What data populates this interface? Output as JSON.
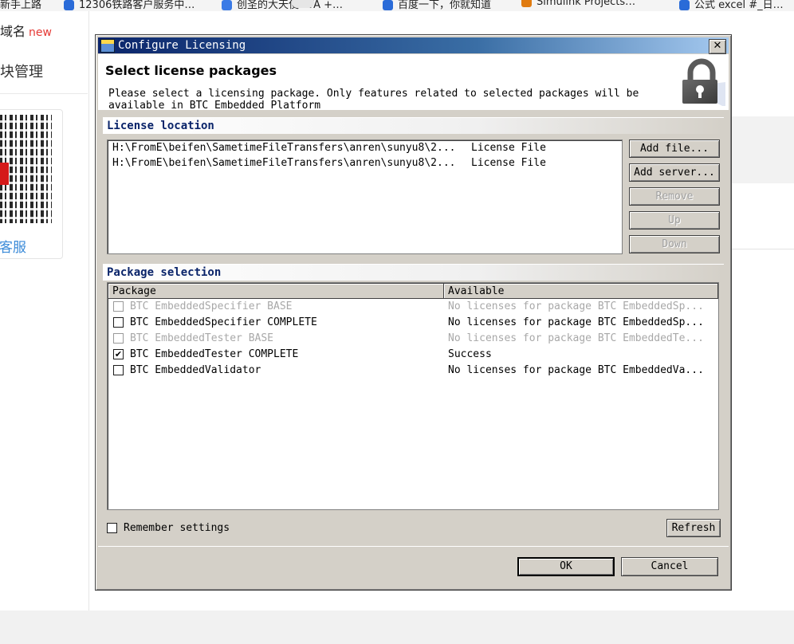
{
  "background": {
    "bookmarks": [
      {
        "label": "新手上路"
      },
      {
        "label": "12306铁路客户服务中…"
      },
      {
        "label": "创圣的大天使OVA +…"
      },
      {
        "label": "百度一下，你就知道"
      },
      {
        "label": "Simulink Projects…"
      },
      {
        "label": "公式 excel #_日…"
      }
    ],
    "left_panel": {
      "truncated_label": "域名",
      "new_badge": "new",
      "manage_label": "块管理",
      "service_label": "客服"
    }
  },
  "dialog": {
    "title": "Configure Licensing",
    "close_glyph": "✕",
    "header_title": "Select license packages",
    "header_description": "Please select a licensing package. Only features related to selected packages will be available in BTC Embedded Platform",
    "license_location": {
      "title": "License location",
      "rows": [
        {
          "path": "H:\\FromE\\beifen\\SametimeFileTransfers\\anren\\sunyu8\\2...",
          "type": "License File"
        },
        {
          "path": "H:\\FromE\\beifen\\SametimeFileTransfers\\anren\\sunyu8\\2...",
          "type": "License File"
        }
      ],
      "buttons": {
        "add_file": "Add file...",
        "add_server": "Add server...",
        "remove": "Remove",
        "up": "Up",
        "down": "Down"
      }
    },
    "package_selection": {
      "title": "Package selection",
      "columns": {
        "package": "Package",
        "available": "Available"
      },
      "rows": [
        {
          "name": "BTC EmbeddedSpecifier BASE",
          "available": "No licenses for package BTC EmbeddedSp...",
          "checked": false,
          "enabled": false
        },
        {
          "name": "BTC EmbeddedSpecifier COMPLETE",
          "available": "No licenses for package BTC EmbeddedSp...",
          "checked": false,
          "enabled": true
        },
        {
          "name": "BTC EmbeddedTester BASE",
          "available": "No licenses for package BTC EmbeddedTe...",
          "checked": false,
          "enabled": false
        },
        {
          "name": "BTC EmbeddedTester COMPLETE",
          "available": "Success",
          "checked": true,
          "enabled": true
        },
        {
          "name": "BTC EmbeddedValidator",
          "available": "No licenses for package BTC EmbeddedVa...",
          "checked": false,
          "enabled": true
        }
      ]
    },
    "remember_settings": {
      "label": "Remember settings",
      "checked": false
    },
    "refresh_label": "Refresh",
    "ok_label": "OK",
    "cancel_label": "Cancel"
  }
}
